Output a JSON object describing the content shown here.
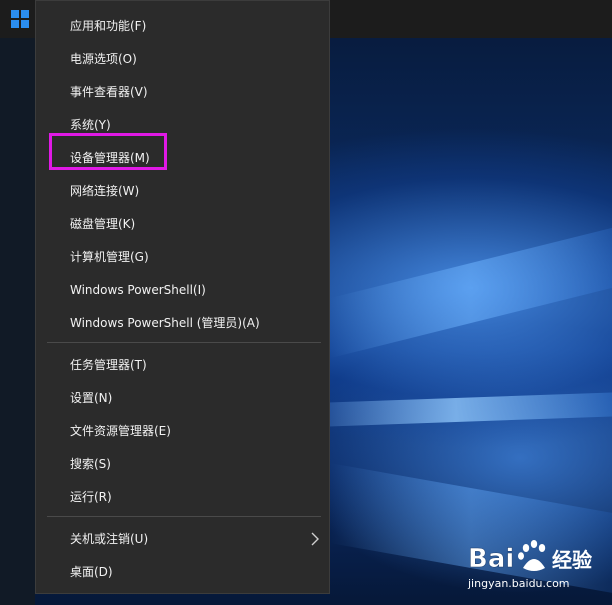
{
  "taskbar": {
    "start_icon": "windows-logo-icon",
    "accent": "#2b8ef0"
  },
  "menu": {
    "background": "#2b2b2b",
    "group1": [
      {
        "label": "应用和功能(F)"
      },
      {
        "label": "电源选项(O)"
      },
      {
        "label": "事件查看器(V)"
      },
      {
        "label": "系统(Y)"
      },
      {
        "label": "设备管理器(M)",
        "highlighted": true
      },
      {
        "label": "网络连接(W)"
      },
      {
        "label": "磁盘管理(K)"
      },
      {
        "label": "计算机管理(G)"
      },
      {
        "label": "Windows PowerShell(I)"
      },
      {
        "label": "Windows PowerShell (管理员)(A)"
      }
    ],
    "group2": [
      {
        "label": "任务管理器(T)"
      },
      {
        "label": "设置(N)"
      },
      {
        "label": "文件资源管理器(E)"
      },
      {
        "label": "搜索(S)"
      },
      {
        "label": "运行(R)"
      }
    ],
    "group3": [
      {
        "label": "关机或注销(U)",
        "submenu_icon": "chevron-right-icon"
      },
      {
        "label": "桌面(D)"
      }
    ],
    "highlight_color": "#e019e6"
  },
  "watermark": {
    "brand": "Bai经验",
    "url": "jingyan.baidu.com"
  }
}
